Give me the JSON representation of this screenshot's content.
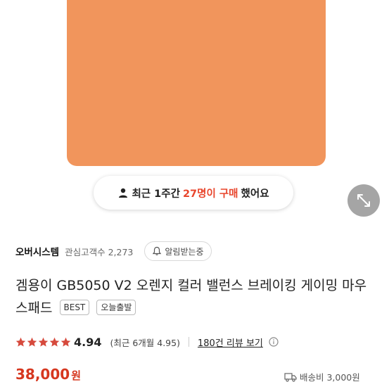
{
  "recent_purchase": {
    "prefix": "최근 1주간",
    "highlight": "27명이 구매",
    "suffix": "했어요"
  },
  "seller": {
    "name": "오버시스템",
    "followers_label": "관심고객수 2,273",
    "notify_label": "알림받는중"
  },
  "product": {
    "title": "겜용이 GB5050 V2 오렌지 컬러 밸런스 브레이킹 게이밍 마우스패드",
    "badges": [
      "BEST",
      "오늘출발"
    ]
  },
  "rating": {
    "value": "4.94",
    "stars": 5,
    "recent": "(최근 6개월 4.95)",
    "review_link": "180건 리뷰 보기"
  },
  "price": {
    "amount": "38,000",
    "currency": "원"
  },
  "shipping": {
    "label": "배송비 3,000원"
  },
  "colors": {
    "product": "#f1955c",
    "accent": "#e8452c",
    "price": "#d6371f",
    "star": "#d64a3d"
  },
  "icons": [
    "person-icon",
    "expand-icon",
    "bell-icon",
    "star-icon",
    "info-icon",
    "truck-icon"
  ]
}
